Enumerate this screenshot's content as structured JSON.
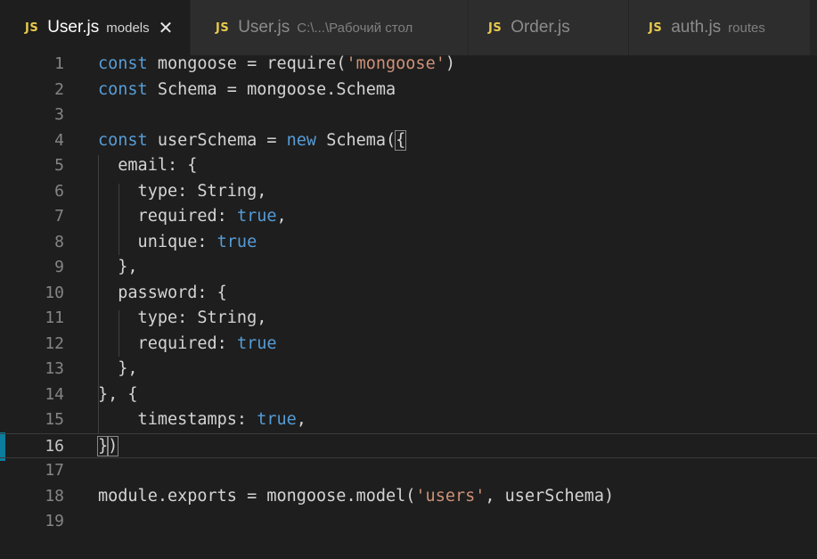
{
  "tabs": [
    {
      "icon": "JS",
      "name": "User.js",
      "desc": "models",
      "close": "✕",
      "active": true
    },
    {
      "icon": "JS",
      "name": "User.js",
      "desc": "C:\\...\\Рабочий стол",
      "active": false
    },
    {
      "icon": "JS",
      "name": "Order.js",
      "desc": "",
      "active": false
    },
    {
      "icon": "JS",
      "name": "auth.js",
      "desc": "routes",
      "active": false
    }
  ],
  "editor": {
    "current_line": 16,
    "lines": [
      {
        "n": "1",
        "tokens": [
          [
            "kw",
            "const"
          ],
          [
            "p",
            " mongoose = require("
          ],
          [
            "str",
            "'mongoose'"
          ],
          [
            "p",
            ")"
          ]
        ]
      },
      {
        "n": "2",
        "tokens": [
          [
            "kw",
            "const"
          ],
          [
            "p",
            " Schema = mongoose.Schema"
          ]
        ]
      },
      {
        "n": "3",
        "tokens": []
      },
      {
        "n": "4",
        "tokens": [
          [
            "kw",
            "const"
          ],
          [
            "p",
            " userSchema = "
          ],
          [
            "kw",
            "new"
          ],
          [
            "p",
            " Schema("
          ],
          [
            "br",
            "{"
          ]
        ]
      },
      {
        "n": "5",
        "tokens": [
          [
            "p",
            "  email: {"
          ]
        ]
      },
      {
        "n": "6",
        "tokens": [
          [
            "p",
            "    type: String,"
          ]
        ]
      },
      {
        "n": "7",
        "tokens": [
          [
            "p",
            "    required: "
          ],
          [
            "bool",
            "true"
          ],
          [
            "p",
            ","
          ]
        ]
      },
      {
        "n": "8",
        "tokens": [
          [
            "p",
            "    unique: "
          ],
          [
            "bool",
            "true"
          ]
        ]
      },
      {
        "n": "9",
        "tokens": [
          [
            "p",
            "  },"
          ]
        ]
      },
      {
        "n": "10",
        "tokens": [
          [
            "p",
            "  password: {"
          ]
        ]
      },
      {
        "n": "11",
        "tokens": [
          [
            "p",
            "    type: String,"
          ]
        ]
      },
      {
        "n": "12",
        "tokens": [
          [
            "p",
            "    required: "
          ],
          [
            "bool",
            "true"
          ]
        ]
      },
      {
        "n": "13",
        "tokens": [
          [
            "p",
            "  },"
          ]
        ]
      },
      {
        "n": "14",
        "tokens": [
          [
            "p",
            "}, {"
          ]
        ]
      },
      {
        "n": "15",
        "tokens": [
          [
            "p",
            "    timestamps: "
          ],
          [
            "bool",
            "true"
          ],
          [
            "p",
            ","
          ]
        ]
      },
      {
        "n": "16",
        "tokens": [
          [
            "br",
            "}"
          ],
          [
            "br",
            ")"
          ]
        ]
      },
      {
        "n": "17",
        "tokens": []
      },
      {
        "n": "18",
        "tokens": [
          [
            "p",
            "module.exports = mongoose.model("
          ],
          [
            "str",
            "'users'"
          ],
          [
            "p",
            ", userSchema)"
          ]
        ]
      },
      {
        "n": "19",
        "tokens": []
      }
    ]
  },
  "colors": {
    "keyword": "#569cd6",
    "string": "#ce9178",
    "text": "#d4d4d4",
    "js_icon": "#e8c94d",
    "background": "#1e1e1e"
  }
}
